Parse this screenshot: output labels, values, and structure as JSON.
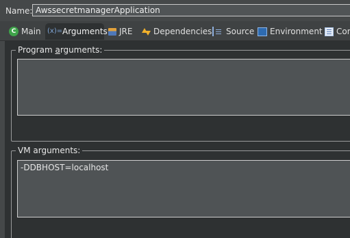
{
  "name_row": {
    "label": "Name:",
    "value": "AwssecretmanagerApplication"
  },
  "tabs": [
    {
      "label": "Main",
      "icon": "main-class-icon",
      "active": false
    },
    {
      "label": "Arguments",
      "icon": "arguments-icon",
      "active": true
    },
    {
      "label": "JRE",
      "icon": "jre-library-icon",
      "active": false
    },
    {
      "label": "Dependencies",
      "icon": "dependencies-icon",
      "active": false
    },
    {
      "label": "Source",
      "icon": "source-lookup-icon",
      "active": false
    },
    {
      "label": "Environment",
      "icon": "environment-icon",
      "active": false
    },
    {
      "label": "Common",
      "icon": "common-icon",
      "active": false
    }
  ],
  "args_icon_text": "(x)=",
  "program_args": {
    "label_pre": "Program ",
    "label_mnemonic": "a",
    "label_post": "rguments:",
    "value": ""
  },
  "vm_args": {
    "label": "VM arguments:",
    "value": "-DDBHOST=localhost"
  }
}
